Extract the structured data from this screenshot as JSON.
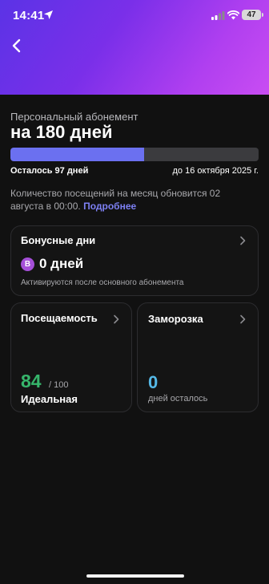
{
  "status_bar": {
    "time": "14:41",
    "battery": "47",
    "icons": [
      "location-arrow-icon",
      "signal-icon",
      "wifi-icon",
      "battery-icon"
    ]
  },
  "header": {
    "back_icon": "chevron-left-icon",
    "gradient_colors": [
      "#5b33e6",
      "#c94df2"
    ]
  },
  "subscription": {
    "subtitle": "Персональный абонемент",
    "title": "на 180 дней",
    "progress_fraction": 0.54,
    "remaining": "Осталось 97 дней",
    "until": "до 16 октября 2025 г.",
    "info_text": "Количество посещений на месяц обновится 02 августа в 00:00.",
    "more_link": "Подробнее"
  },
  "bonus": {
    "title": "Бонусные дни",
    "badge": "B",
    "value": "0 дней",
    "description": "Активируются после основного абонемента"
  },
  "attendance": {
    "title": "Посещаемость",
    "value": "84",
    "max": "/ 100",
    "status": "Идеальная",
    "value_color": "#36b56b"
  },
  "freeze": {
    "title": "Заморозка",
    "value": "0",
    "description": "дней осталось",
    "value_color": "#55b8e6"
  },
  "colors": {
    "accent": "#6b70f0",
    "link": "#7d80f3",
    "background": "#111111"
  }
}
